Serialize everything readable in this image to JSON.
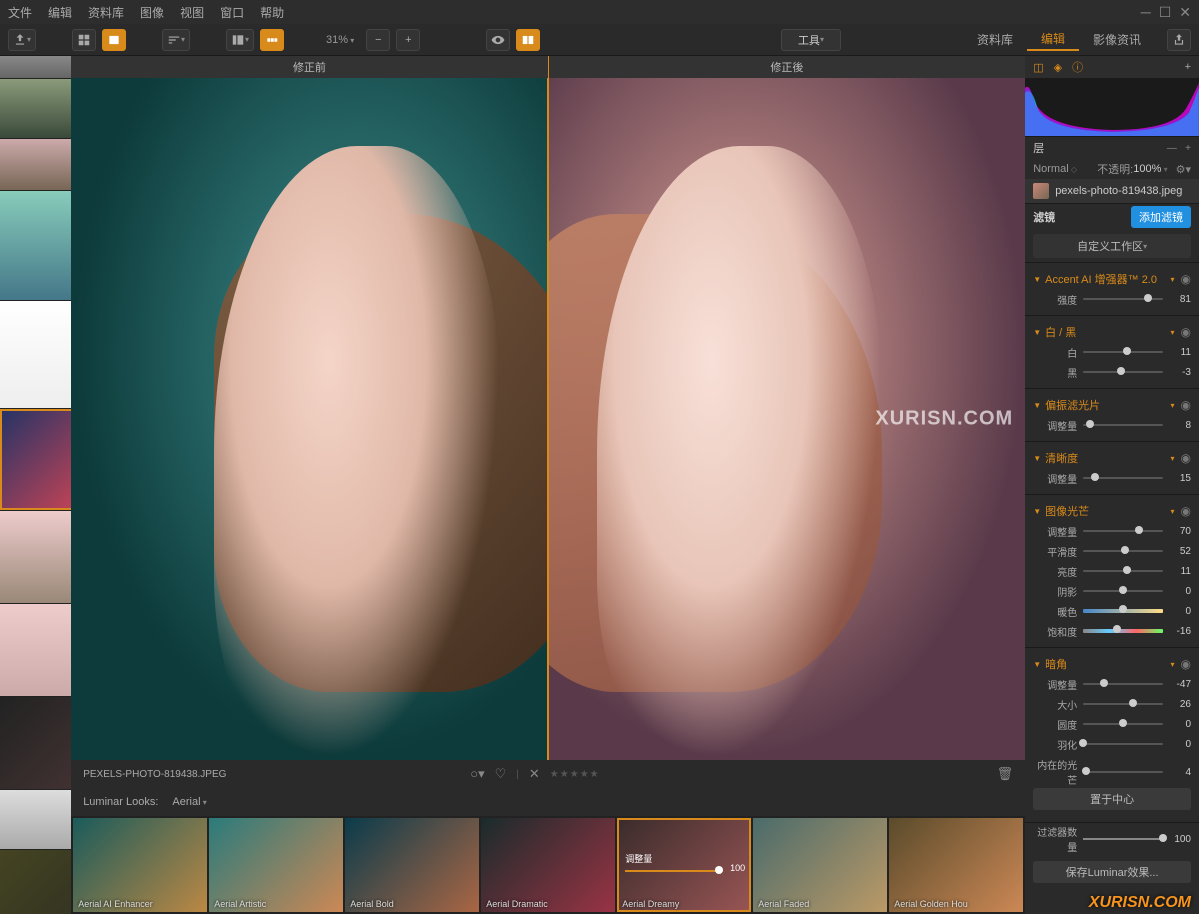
{
  "menu": [
    "文件",
    "编辑",
    "资料库",
    "图像",
    "视图",
    "窗口",
    "帮助"
  ],
  "toolbar": {
    "zoom": "31%",
    "tools_label": "工具"
  },
  "right_tabs": [
    "资料库",
    "编辑",
    "影像资讯"
  ],
  "active_tab": 1,
  "before_label": "修正前",
  "after_label": "修正後",
  "filename_display": "PEXELS-PHOTO-819438.JPEG",
  "looks_label": "Luminar Looks:",
  "looks_category": "Aerial",
  "looks": [
    {
      "name": "Aerial AI Enhancer"
    },
    {
      "name": "Aerial Artistic"
    },
    {
      "name": "Aerial Bold"
    },
    {
      "name": "Aerial Dramatic"
    },
    {
      "name": "Aerial Dreamy",
      "slider_label": "调整量",
      "value": 100,
      "selected": true
    },
    {
      "name": "Aerial Faded"
    },
    {
      "name": "Aerial Golden Hou"
    }
  ],
  "layers": {
    "title": "层",
    "blend": "Normal",
    "opacity_label": "不透明:",
    "opacity": "100%",
    "layer_name": "pexels-photo-819438.jpeg"
  },
  "filters": {
    "title": "滤镜",
    "add_label": "添加滤镜",
    "workspace": "自定义工作区",
    "groups": [
      {
        "name": "Accent AI 增强器™ 2.0",
        "sliders": [
          {
            "label": "强度",
            "value": 81,
            "pct": 81
          }
        ]
      },
      {
        "name": "白 / 黑",
        "sliders": [
          {
            "label": "白",
            "value": 11,
            "pct": 55
          },
          {
            "label": "黑",
            "value": -3,
            "pct": 48
          }
        ]
      },
      {
        "name": "偏振滤光片",
        "sliders": [
          {
            "label": "调整量",
            "value": 8,
            "pct": 8
          }
        ]
      },
      {
        "name": "清晰度",
        "sliders": [
          {
            "label": "调整量",
            "value": 15,
            "pct": 15
          }
        ]
      },
      {
        "name": "图像光芒",
        "sliders": [
          {
            "label": "调整量",
            "value": 70,
            "pct": 70
          },
          {
            "label": "平滑度",
            "value": 52,
            "pct": 52
          },
          {
            "label": "亮度",
            "value": 11,
            "pct": 55
          },
          {
            "label": "阴影",
            "value": 0,
            "pct": 50
          },
          {
            "label": "暖色",
            "value": 0,
            "pct": 50,
            "grad": true
          },
          {
            "label": "饱和度",
            "value": -16,
            "pct": 42,
            "grad2": true
          }
        ]
      },
      {
        "name": "暗角",
        "sliders": [
          {
            "label": "调整量",
            "value": -47,
            "pct": 26
          },
          {
            "label": "大小",
            "value": 26,
            "pct": 63
          },
          {
            "label": "圆度",
            "value": 0,
            "pct": 50
          },
          {
            "label": "羽化",
            "value": 0,
            "pct": 0
          }
        ],
        "extra": [
          {
            "label": "内在的光芒",
            "value": 4,
            "pct": 4
          }
        ],
        "center_btn": "置于中心"
      }
    ],
    "count_label": "过滤器数量",
    "count_value": 100,
    "save_label": "保存Luminar效果..."
  },
  "watermark": "XURISN.COM",
  "watermark2": "XURISN.COM"
}
